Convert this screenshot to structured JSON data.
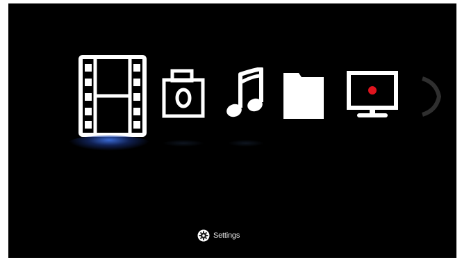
{
  "menu": {
    "items": [
      {
        "icon": "film-strip-icon",
        "selected": true
      },
      {
        "icon": "camera-icon",
        "selected": false
      },
      {
        "icon": "music-note-icon",
        "selected": false
      },
      {
        "icon": "folder-icon",
        "selected": false
      },
      {
        "icon": "tv-record-icon",
        "selected": false
      },
      {
        "icon": "partial-item-icon",
        "selected": false
      }
    ],
    "selection_color": "#2f5fd0"
  },
  "settings": {
    "label": "Settings",
    "icon": "gear-icon"
  },
  "colors": {
    "background": "#000000",
    "icon": "#ffffff",
    "record_dot": "#e0141e"
  }
}
